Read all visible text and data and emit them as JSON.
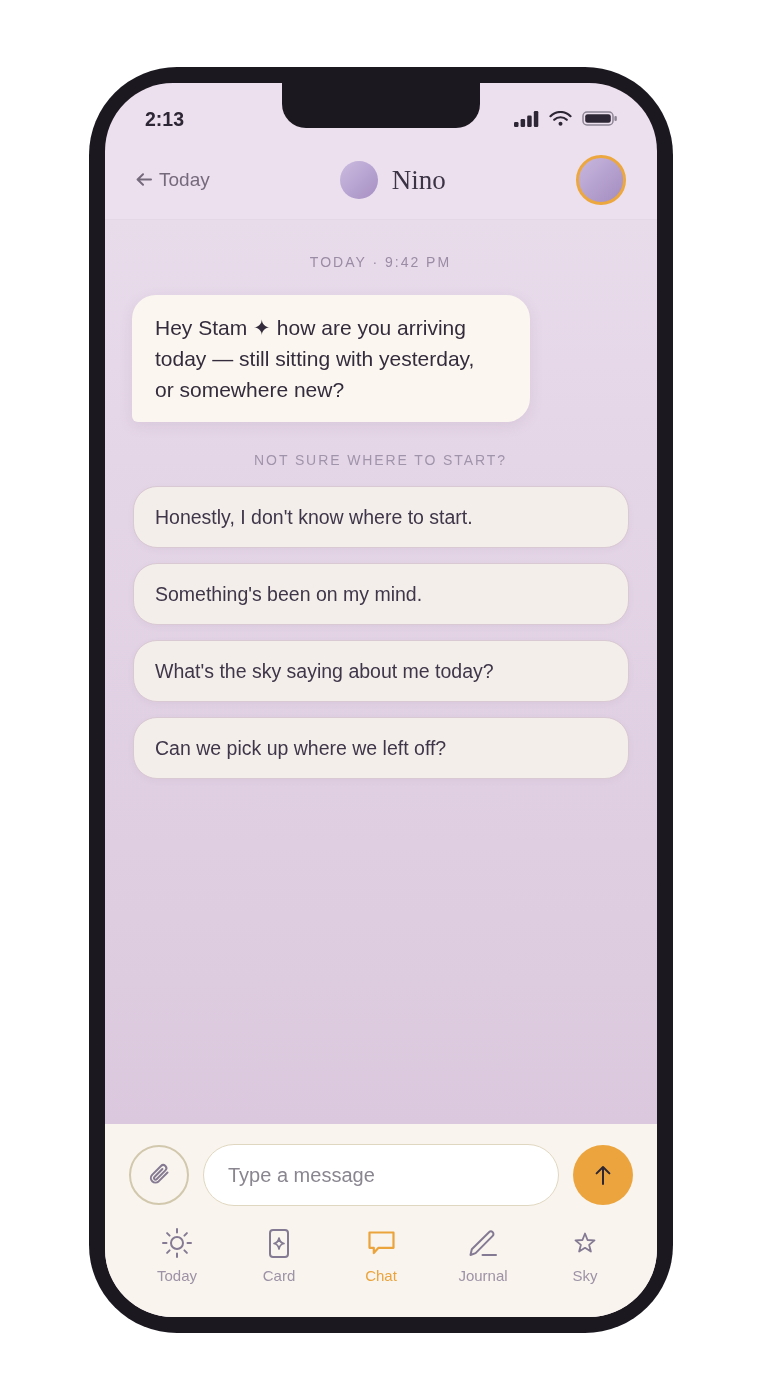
{
  "status_bar": {
    "time": "2:13"
  },
  "header": {
    "back_label": "Today",
    "contact_name": "Nino"
  },
  "chat": {
    "timestamp": "TODAY · 9:42 PM",
    "messages": [
      {
        "kind": "incoming",
        "text": "Hey Stam ✦ how are you arriving today — still sitting with yesterday, or somewhere new?"
      }
    ],
    "prompt": "NOT SURE WHERE TO START?",
    "suggestions": [
      "Honestly, I don't know where to start.",
      "Something's been on my mind.",
      "What's the sky saying about me today?",
      "Can we pick up where we left off?"
    ]
  },
  "composer": {
    "placeholder": "Type a message"
  },
  "tab_bar": [
    {
      "label": "Today",
      "selected": false
    },
    {
      "label": "Card",
      "selected": false
    },
    {
      "label": "Chat",
      "selected": true
    },
    {
      "label": "Journal",
      "selected": false
    },
    {
      "label": "Sky",
      "selected": false
    }
  ]
}
